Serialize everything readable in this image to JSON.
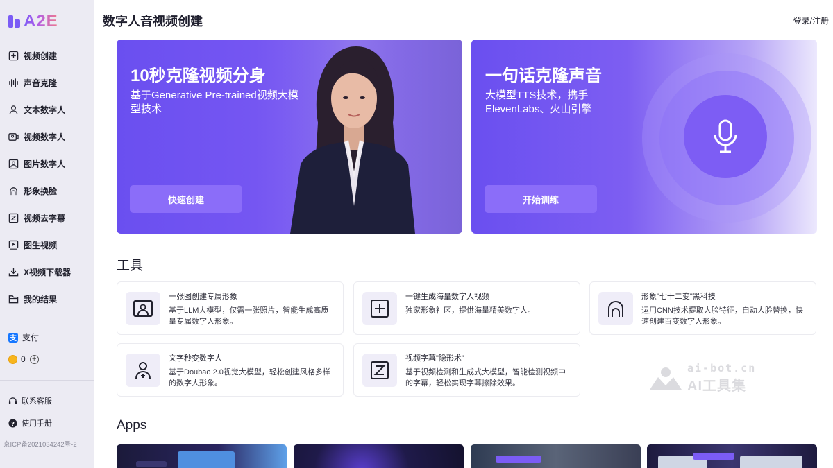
{
  "brand": {
    "logo_text": "A2E"
  },
  "header": {
    "title": "数字人音视频创建",
    "login": "登录/注册"
  },
  "sidebar": {
    "items": [
      {
        "label": "视频创建",
        "icon": "plus-square-icon"
      },
      {
        "label": "声音克隆",
        "icon": "waveform-icon"
      },
      {
        "label": "文本数字人",
        "icon": "person-icon"
      },
      {
        "label": "视频数字人",
        "icon": "video-person-icon"
      },
      {
        "label": "图片数字人",
        "icon": "image-person-icon"
      },
      {
        "label": "形象换脸",
        "icon": "face-swap-icon"
      },
      {
        "label": "视频去字幕",
        "icon": "subtitle-remove-icon"
      },
      {
        "label": "图生视频",
        "icon": "play-square-icon"
      },
      {
        "label": "X视频下载器",
        "icon": "download-icon"
      },
      {
        "label": "我的结果",
        "icon": "folder-icon"
      }
    ],
    "pay": {
      "icon_text": "支",
      "label": "支付"
    },
    "coins": {
      "value": "0"
    },
    "support": {
      "label": "联系客服"
    },
    "manual": {
      "label": "使用手册"
    },
    "icp": "京ICP备2021034242号-2"
  },
  "banners": [
    {
      "title": "10秒克隆视频分身",
      "subtitle": "基于Generative Pre-trained视频大模型技术",
      "button": "快速创建"
    },
    {
      "title": "一句话克隆声音",
      "subtitle_line1": "大模型TTS技术，携手",
      "subtitle_line2": "ElevenLabs、火山引擎",
      "button": "开始训练"
    }
  ],
  "tools": {
    "section_title": "工具",
    "cards": [
      {
        "title": "一张图创建专属形象",
        "desc": "基于LLM大模型，仅需一张照片，智能生成高质量专属数字人形象。",
        "icon": "portrait-frame-icon"
      },
      {
        "title": "一键生成海量数字人视频",
        "desc": "独家形象社区，提供海量精美数字人。",
        "icon": "plus-box-icon"
      },
      {
        "title": "形象\"七十二变\"黑科技",
        "desc": "运用CNN技术提取人脸特征，自动人脸替换，快速创建百变数字人形象。",
        "icon": "face-outline-icon"
      },
      {
        "title": "文字秒变数字人",
        "desc": "基于Doubao 2.0视觉大模型，轻松创建风格多样的数字人形象。",
        "icon": "person-add-icon"
      },
      {
        "title": "视频字幕\"隐形术\"",
        "desc": "基于视频检测和生成式大模型，智能检测视频中的字幕，轻松实现字幕擦除效果。",
        "icon": "subtitle-erase-icon"
      }
    ]
  },
  "watermark": {
    "top": "ai-bot.cn",
    "bottom": "AI工具集"
  },
  "apps": {
    "section_title": "Apps"
  },
  "colors": {
    "accent": "#7b5cf5",
    "sidebar_bg": "#ecebf3",
    "banner_purple": "#6a4ff0"
  }
}
